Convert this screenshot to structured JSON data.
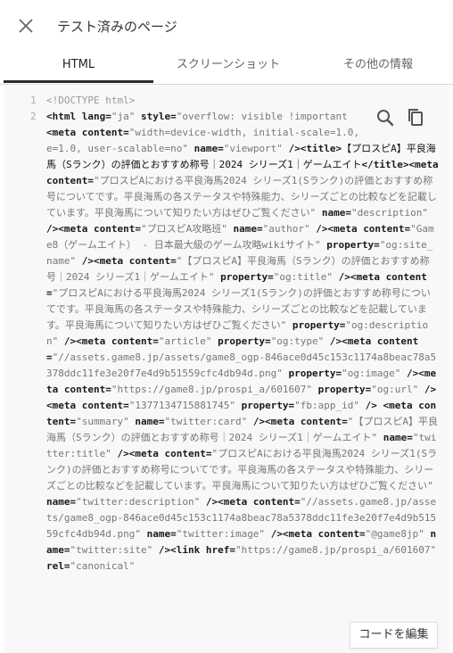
{
  "header": {
    "title": "テスト済みのページ"
  },
  "tabs": [
    {
      "label": "HTML"
    },
    {
      "label": "スクリーンショット"
    },
    {
      "label": "その他の情報"
    }
  ],
  "editor": {
    "line_numbers": [
      "1",
      "2"
    ],
    "edit_label": "コードを編集"
  },
  "colors": {
    "accent": "#2b2b2b",
    "code_bg": "#f8f8f8"
  }
}
